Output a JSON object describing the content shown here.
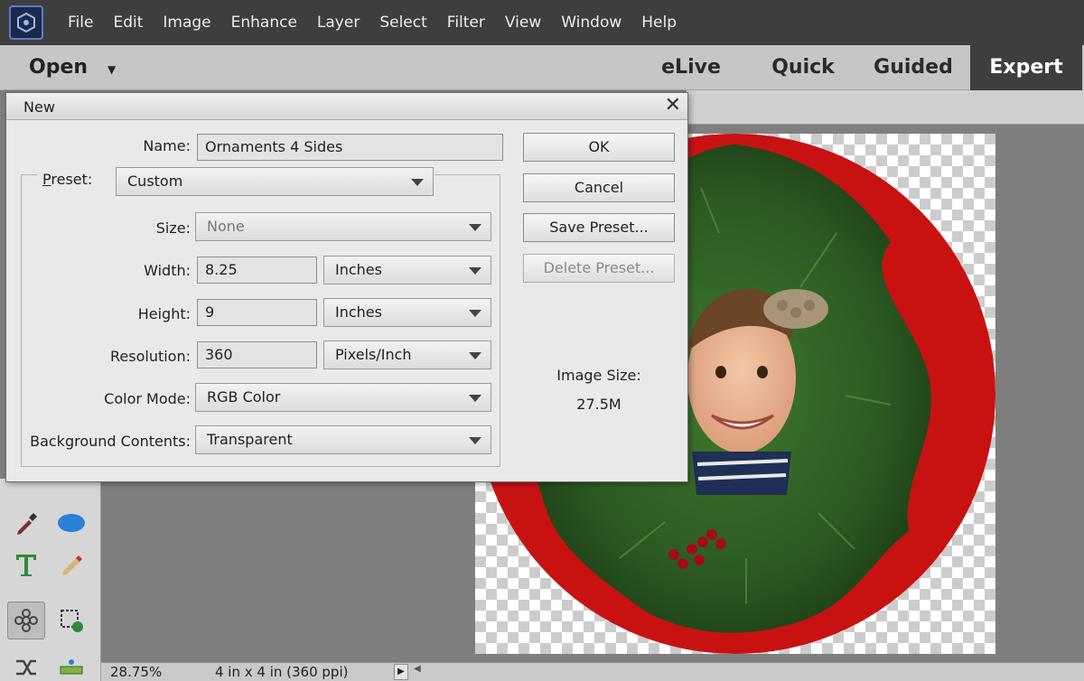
{
  "menu": [
    "File",
    "Edit",
    "Image",
    "Enhance",
    "Layer",
    "Select",
    "Filter",
    "View",
    "Window",
    "Help"
  ],
  "modebar": {
    "open_label": "Open",
    "tabs": [
      "eLive",
      "Quick",
      "Guided",
      "Expert"
    ],
    "active_tab": "Expert"
  },
  "dialog": {
    "title": "New",
    "name_label": "Name:",
    "name_value": "Ornaments 4 Sides",
    "preset_label": "Preset:",
    "preset_value": "Custom",
    "size_label": "Size:",
    "size_value": "None",
    "width_label": "Width:",
    "width_value": "8.25",
    "width_unit": "Inches",
    "height_label": "Height:",
    "height_value": "9",
    "height_unit": "Inches",
    "resolution_label": "Resolution:",
    "resolution_value": "360",
    "resolution_unit": "Pixels/Inch",
    "color_mode_label": "Color Mode:",
    "color_mode_value": "RGB Color",
    "background_label": "Background Contents:",
    "background_value": "Transparent",
    "buttons": {
      "ok": "OK",
      "cancel": "Cancel",
      "save_preset": "Save Preset...",
      "delete_preset": "Delete Preset..."
    },
    "image_size_label": "Image Size:",
    "image_size_value": "27.5M"
  },
  "status": {
    "zoom": "28.75%",
    "doc_info": "4 in x 4 in (360 ppi)"
  },
  "colors": {
    "menubar_bg": "#3e3e3e",
    "ornament_red": "#c81212",
    "greenery": "#2f5a24"
  }
}
